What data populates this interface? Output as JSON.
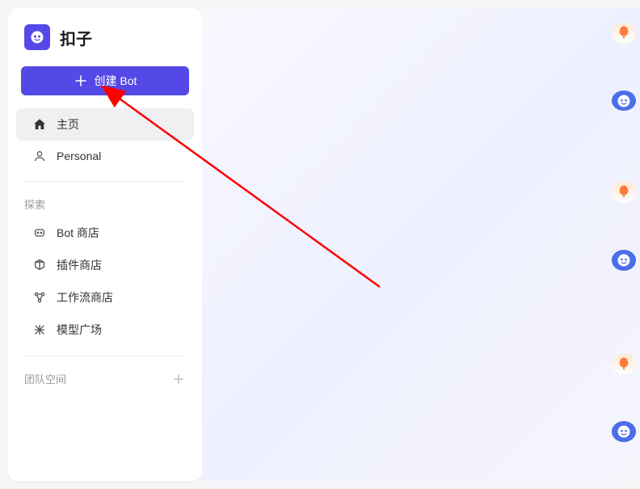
{
  "brand": {
    "name": "扣子"
  },
  "sidebar": {
    "create_button": "创建 Bot",
    "nav": [
      {
        "label": "主页",
        "icon": "home-icon",
        "active": true
      },
      {
        "label": "Personal",
        "icon": "person-icon",
        "active": false
      }
    ],
    "explore_title": "探索",
    "explore_items": [
      {
        "label": "Bot 商店",
        "icon": "bot-store-icon"
      },
      {
        "label": "插件商店",
        "icon": "plugin-store-icon"
      },
      {
        "label": "工作流商店",
        "icon": "workflow-store-icon"
      },
      {
        "label": "模型广场",
        "icon": "model-plaza-icon"
      }
    ],
    "team_space_title": "团队空间"
  },
  "annotation": {
    "arrow_color": "#ff0000"
  }
}
